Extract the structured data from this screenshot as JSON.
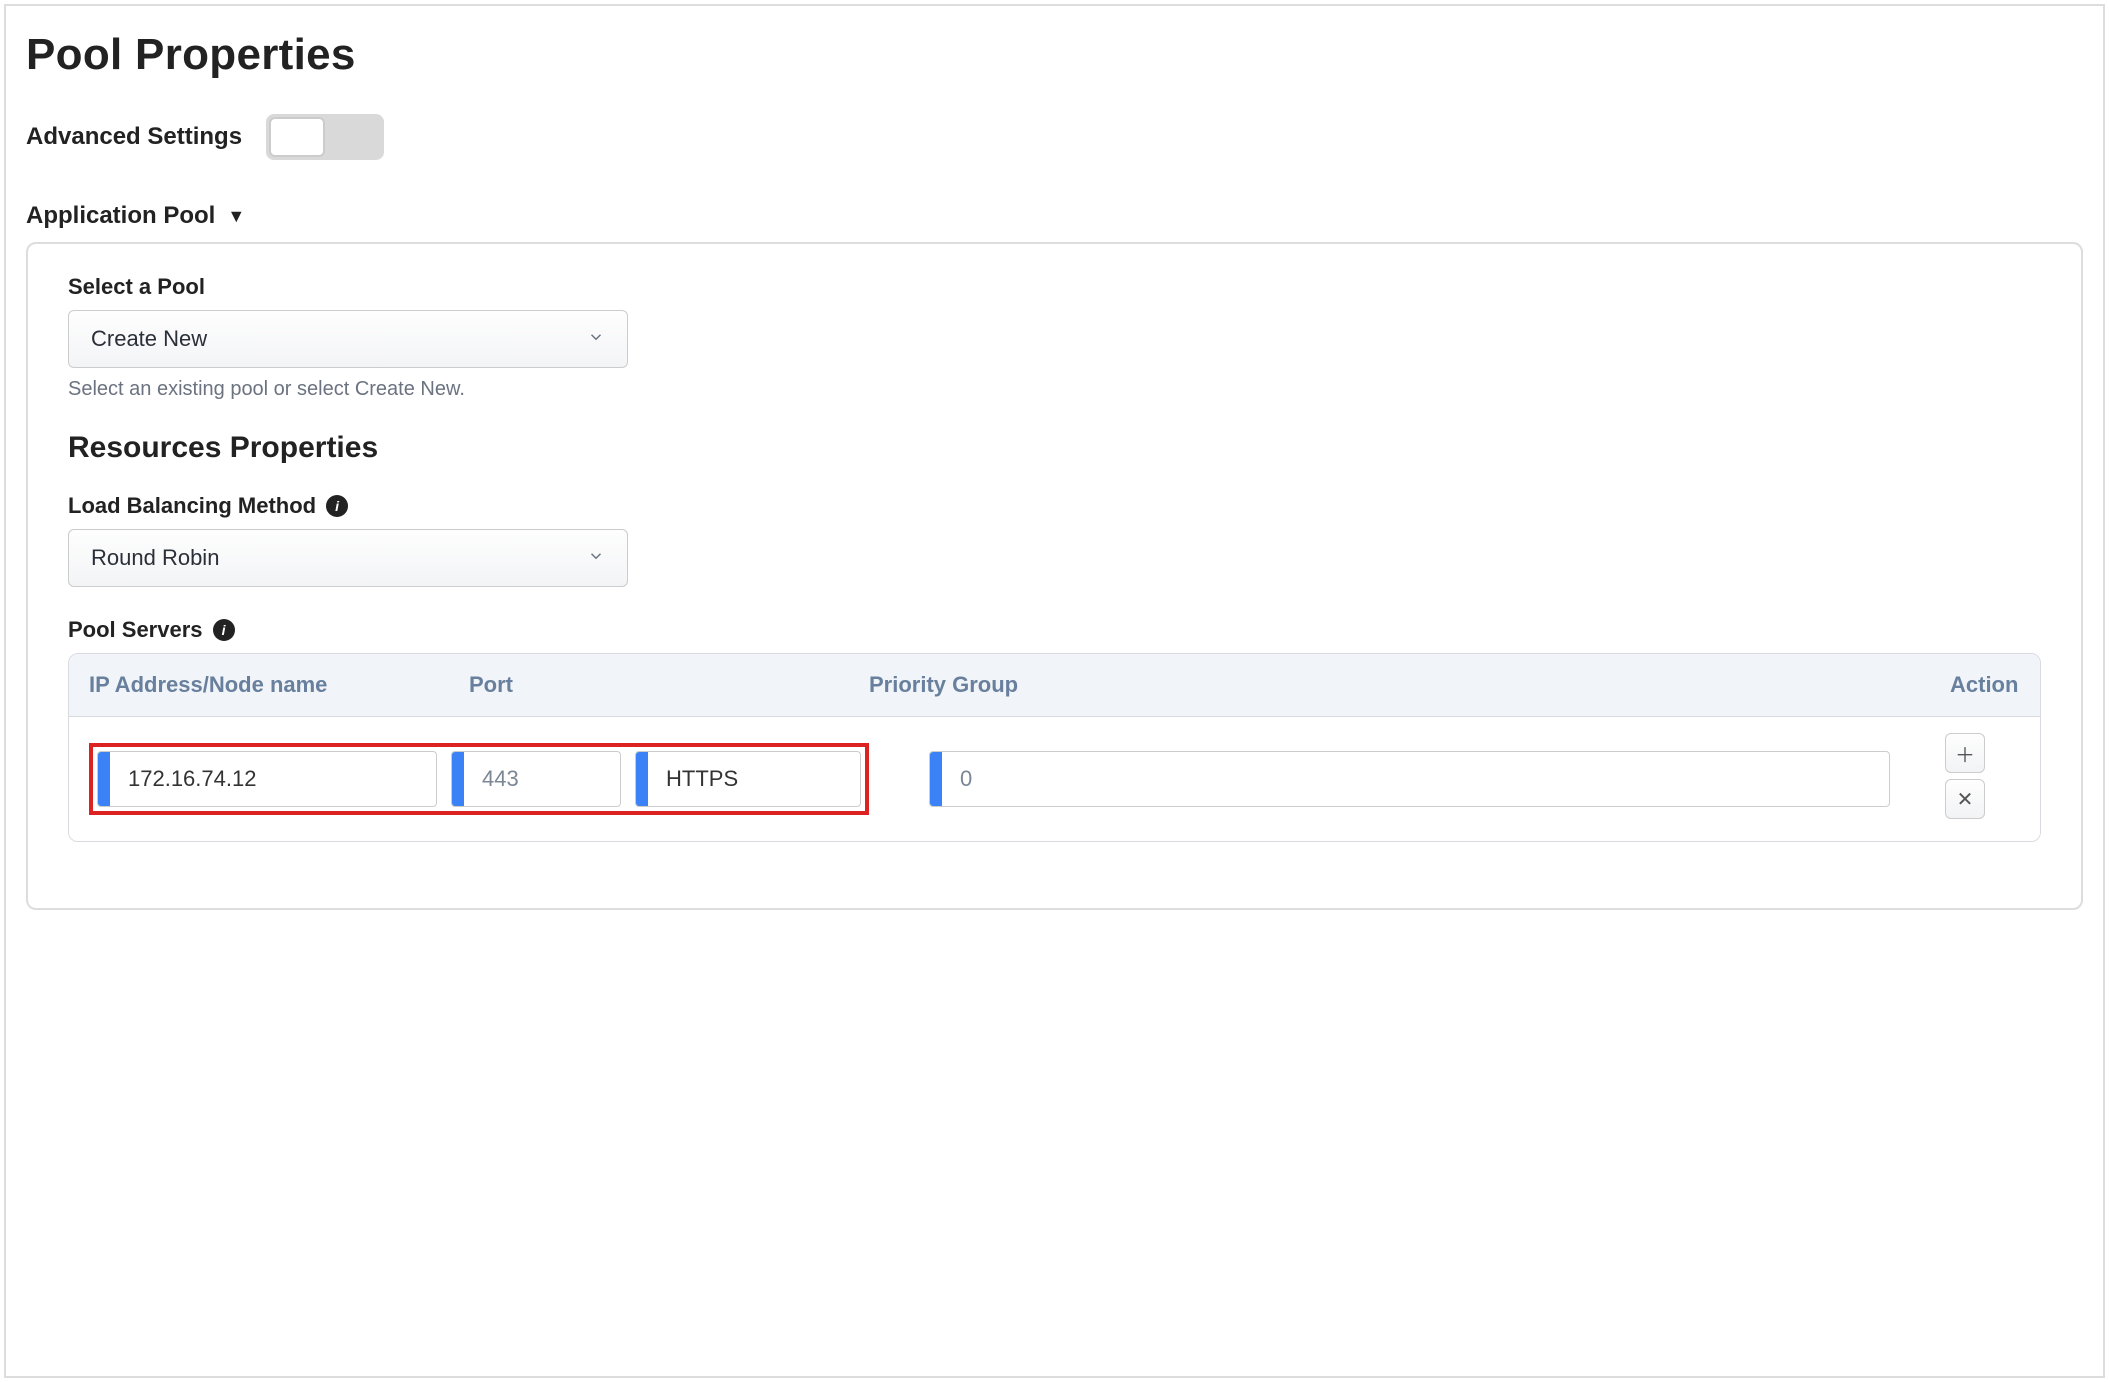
{
  "page_title": "Pool Properties",
  "advanced_settings_label": "Advanced Settings",
  "advanced_settings_on": false,
  "section": {
    "title": "Application Pool",
    "expanded": true,
    "select_pool": {
      "label": "Select a Pool",
      "value": "Create New",
      "help": "Select an existing pool or select Create New."
    },
    "resources_heading": "Resources Properties",
    "lb_method": {
      "label": "Load Balancing Method",
      "value": "Round Robin"
    },
    "pool_servers_label": "Pool Servers",
    "table": {
      "headers": {
        "ip": "IP Address/Node name",
        "port": "Port",
        "priority": "Priority Group",
        "action": "Action"
      },
      "rows": [
        {
          "ip": "172.16.74.12",
          "port": "443",
          "protocol": "HTTPS",
          "priority": "0"
        }
      ]
    }
  }
}
